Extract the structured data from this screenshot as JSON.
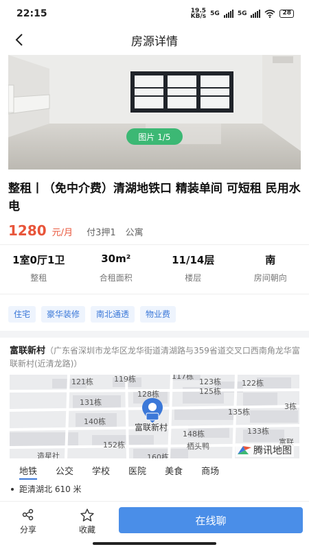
{
  "status_bar": {
    "time": "22:15",
    "net_speed_value": "19.5",
    "net_speed_unit": "KB/s",
    "sim1": "5G",
    "sim2": "5G",
    "battery": "28"
  },
  "nav": {
    "title": "房源详情",
    "back_icon": "chevron-left-icon"
  },
  "gallery": {
    "counter": "图片 1/5",
    "current": 1,
    "total": 5
  },
  "listing": {
    "title": "整租丨（免中介费）清湖地铁口 精装单间 可短租 民用水电",
    "price": "1280",
    "price_unit": "元/月",
    "payment": "付3押1",
    "category": "公寓"
  },
  "specs": [
    {
      "value": "1室0厅1卫",
      "label": "整租"
    },
    {
      "value": "30m²",
      "label": "合租面积"
    },
    {
      "value": "11/14层",
      "label": "楼层"
    },
    {
      "value": "南",
      "label": "房间朝向"
    }
  ],
  "tags": [
    "住宅",
    "豪华装修",
    "南北通透",
    "物业费"
  ],
  "address": {
    "name": "富联新村",
    "detail": "（广东省深圳市龙华区龙华街道清湖路与359省道交叉口西南角龙华富联新村(近清龙路)）"
  },
  "map": {
    "center_label": "富联新村",
    "brand": "腾讯地图",
    "building_labels": [
      "121栋",
      "119栋",
      "117栋",
      "123栋",
      "122栋",
      "131栋",
      "128栋",
      "125栋",
      "140栋",
      "135栋",
      "3栋",
      "148栋",
      "133栋",
      "152栋",
      "栖头鸭",
      "160栋",
      "造星社",
      "富联"
    ]
  },
  "poi": {
    "tabs": [
      "地铁",
      "公交",
      "学校",
      "医院",
      "美食",
      "商场"
    ],
    "active_tab": "地铁",
    "items": [
      "距清湖北 610 米"
    ]
  },
  "bottom_bar": {
    "share": "分享",
    "favorite": "收藏",
    "chat": "在线聊"
  },
  "colors": {
    "accent": "#4a8ee8",
    "price": "#e8553a",
    "tag_text": "#3b78d8",
    "counter_bg": "#3cb874"
  }
}
